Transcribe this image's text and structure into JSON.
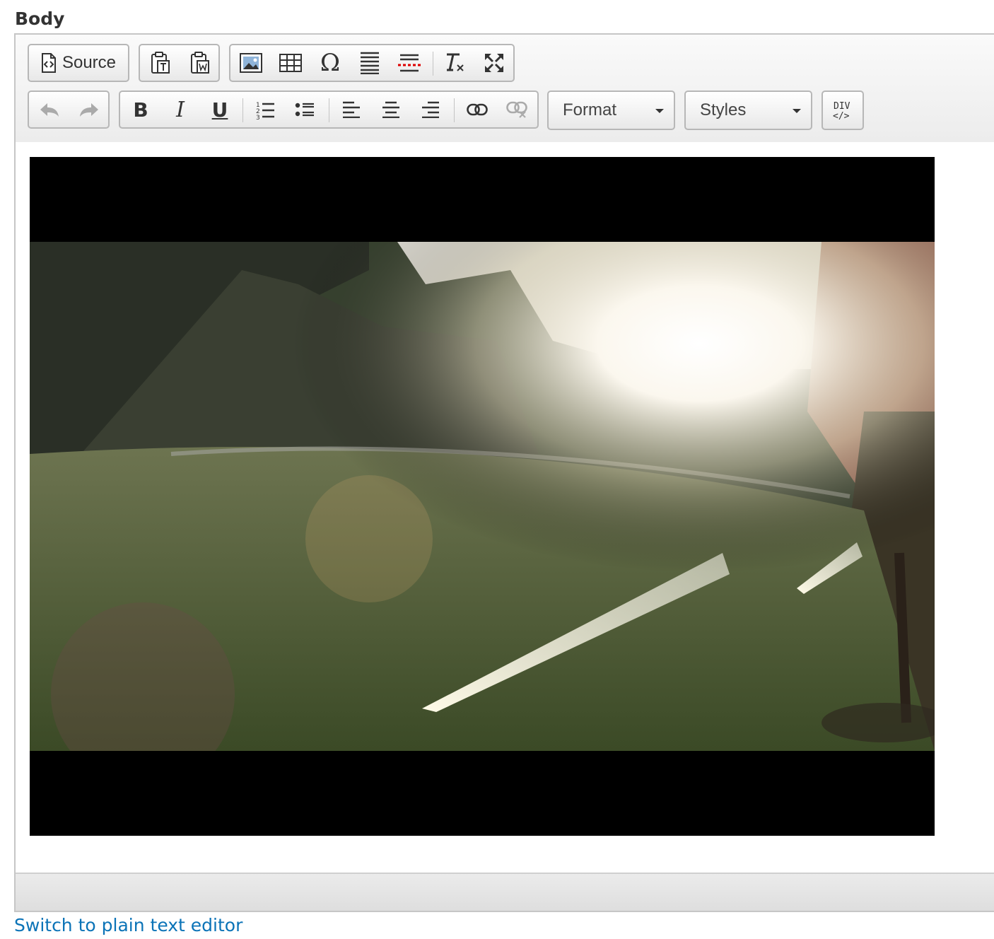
{
  "field": {
    "label": "Body"
  },
  "toolbar": {
    "row1": {
      "source": {
        "label": "Source",
        "icon": "source-icon"
      },
      "clipboard": [
        "paste-text-icon",
        "paste-from-word-icon"
      ],
      "insert": [
        "image-icon",
        "table-icon",
        "special-character-icon",
        "horizontal-line-icon",
        "page-break-icon"
      ],
      "tools": [
        "remove-format-icon",
        "maximize-icon"
      ]
    },
    "row2": {
      "history": [
        "undo-icon",
        "redo-icon"
      ],
      "formatting": [
        "bold-icon",
        "italic-icon",
        "underline-icon",
        "numbered-list-icon",
        "bulleted-list-icon",
        "align-left-icon",
        "align-center-icon",
        "align-right-icon",
        "link-icon",
        "unlink-icon"
      ],
      "format_combo": {
        "label": "Format"
      },
      "styles_combo": {
        "label": "Styles"
      },
      "div_button": {
        "icon": "create-div-icon"
      }
    }
  },
  "content": {
    "embedded": "video-thumbnail"
  },
  "footer": {
    "switch_link": "Switch to plain text editor"
  },
  "colors": {
    "link": "#0b73b7",
    "border": "#b7b7b7",
    "toolbar_bg": "#f2f2f2"
  }
}
